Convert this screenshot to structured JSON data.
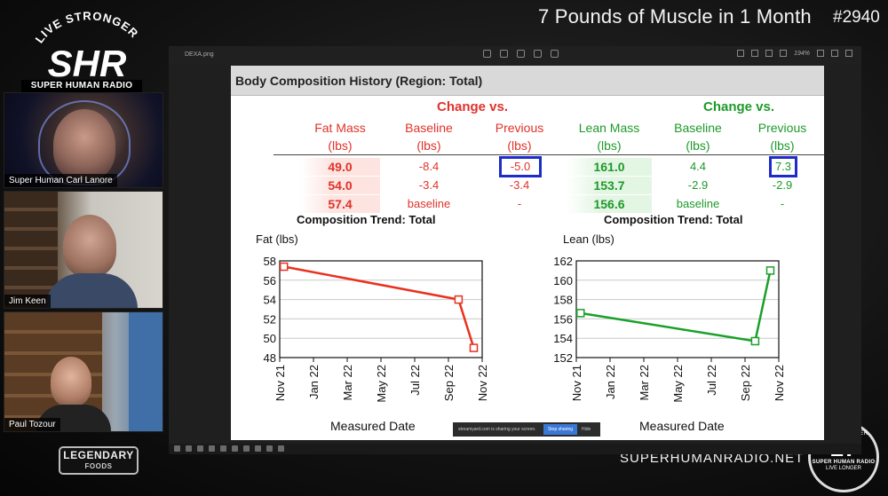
{
  "episode": {
    "title": "7 Pounds of Muscle in 1 Month",
    "number": "#2940"
  },
  "logo": {
    "arc_text": "LIVE STRONGER",
    "brand": "SHR",
    "tagline": "SUPER HUMAN RADIO",
    "sub": "LIVE LONGER"
  },
  "participants": [
    {
      "name": "Super Human Carl Lanore"
    },
    {
      "name": "Jim Keen"
    },
    {
      "name": "Paul Tozour"
    }
  ],
  "sponsor": {
    "name": "LEGENDARY",
    "sub": "FOODS"
  },
  "site_url": "SUPERHUMANRADIO.NET",
  "badge": {
    "top": "LIVE STRONGER",
    "number": "17",
    "middle": "SUPER HUMAN RADIO",
    "bottom": "LIVE LONGER"
  },
  "viewer": {
    "filename": "DEXA.png",
    "zoom": "194%"
  },
  "share_bar": {
    "message": "streamyard.com is sharing your screen.",
    "stop_label": "Stop sharing",
    "hide_label": "Hide"
  },
  "report": {
    "title": "Body Composition History (Region: Total)",
    "fat_group": "Change vs.",
    "lean_group": "Change vs.",
    "headers": {
      "fat_mass": [
        "Fat Mass",
        "(lbs)"
      ],
      "fat_baseline": [
        "Baseline",
        "(lbs)"
      ],
      "fat_previous": [
        "Previous",
        "(lbs)"
      ],
      "lean_mass": [
        "Lean Mass",
        "(lbs)"
      ],
      "lean_baseline": [
        "Baseline",
        "(lbs)"
      ],
      "lean_previous": [
        "Previous",
        "(lbs)"
      ]
    },
    "rows": [
      {
        "fat": "49.0",
        "fat_base": "-8.4",
        "fat_prev": "-5.0",
        "lean": "161.0",
        "lean_base": "4.4",
        "lean_prev": "7.3"
      },
      {
        "fat": "54.0",
        "fat_base": "-3.4",
        "fat_prev": "-3.4",
        "lean": "153.7",
        "lean_base": "-2.9",
        "lean_prev": "-2.9"
      },
      {
        "fat": "57.4",
        "fat_base": "baseline",
        "fat_prev": "-",
        "lean": "156.6",
        "lean_base": "baseline",
        "lean_prev": "-"
      }
    ]
  },
  "chart_data": [
    {
      "type": "line",
      "title": "Composition Trend: Total",
      "ylabel": "Fat (lbs)",
      "xlabel": "Measured Date",
      "x_ticks": [
        "Nov 21",
        "Jan 22",
        "Mar 22",
        "May 22",
        "Jul 22",
        "Sep 22",
        "Nov 22"
      ],
      "y_ticks": [
        48,
        50,
        52,
        54,
        56,
        58
      ],
      "ylim": [
        48,
        58
      ],
      "color": "#e8321f",
      "series": [
        {
          "x": [
            0.25,
            10.6,
            11.5
          ],
          "values": [
            57.4,
            54.0,
            49.0
          ]
        }
      ]
    },
    {
      "type": "line",
      "title": "Composition Trend: Total",
      "ylabel": "Lean (lbs)",
      "xlabel": "Measured Date",
      "x_ticks": [
        "Nov 21",
        "Jan 22",
        "Mar 22",
        "May 22",
        "Jul 22",
        "Sep 22",
        "Nov 22"
      ],
      "y_ticks": [
        152,
        154,
        156,
        158,
        160,
        162
      ],
      "ylim": [
        152,
        162
      ],
      "color": "#1aa02a",
      "series": [
        {
          "x": [
            0.25,
            10.6,
            11.5
          ],
          "values": [
            156.6,
            153.7,
            161.0
          ]
        }
      ]
    }
  ]
}
